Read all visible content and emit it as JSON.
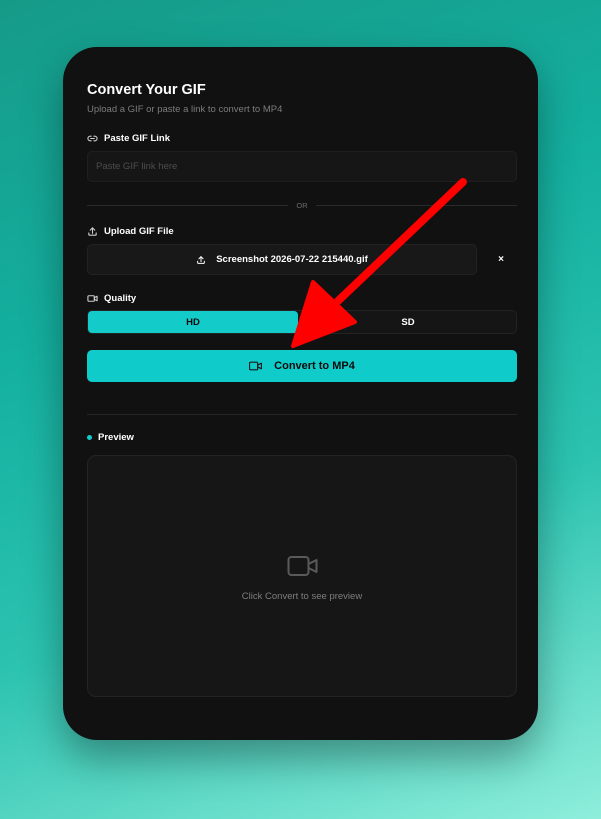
{
  "card": {
    "title": "Convert Your GIF",
    "subtitle": "Upload a GIF or paste a link to convert to MP4"
  },
  "link_section": {
    "label": "Paste GIF Link",
    "icon": "link-icon",
    "placeholder": "Paste GIF link here",
    "value": ""
  },
  "divider": {
    "text": "OR"
  },
  "upload_section": {
    "label": "Upload GIF File",
    "icon": "upload-icon",
    "file_name": "Screenshot 2026-07-22 215440.gif",
    "clear_label": "×"
  },
  "quality": {
    "label": "Quality",
    "icon": "video-icon",
    "options": [
      "HD",
      "SD"
    ],
    "selected": "HD"
  },
  "convert_button": {
    "label": "Convert to MP4",
    "icon": "video-icon"
  },
  "preview": {
    "label": "Preview",
    "empty_text": "Click Convert to see preview",
    "icon": "video-icon"
  },
  "colors": {
    "accent": "#13cbc9",
    "card_bg": "#111111",
    "annotation_arrow": "#ff0000"
  }
}
